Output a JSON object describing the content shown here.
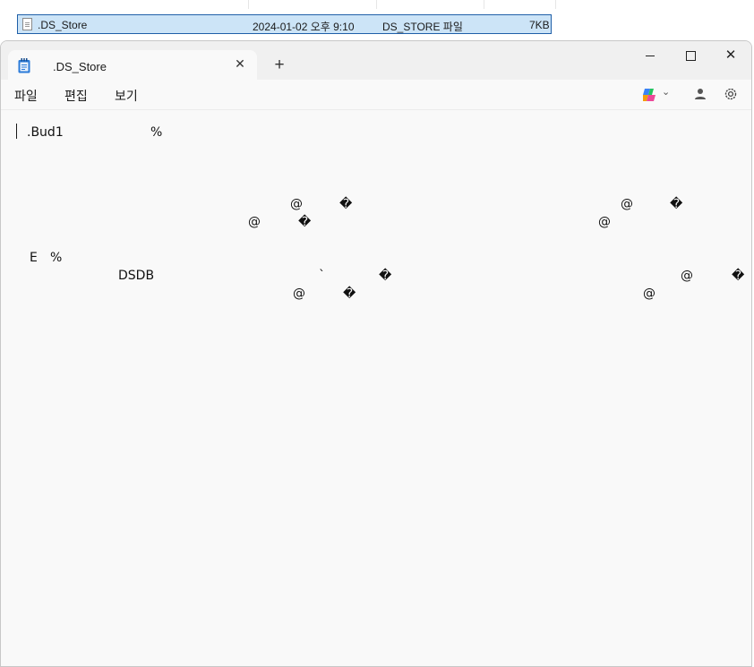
{
  "explorer": {
    "file_row": {
      "name": ".DS_Store",
      "date_modified": "2024-01-02 오후 9:10",
      "type": "DS_STORE 파일",
      "size": "7KB"
    }
  },
  "notepad": {
    "tab_title": ".DS_Store",
    "tab_close_glyph": "✕",
    "new_tab_glyph": "+",
    "window_buttons": {
      "minimize_icon": "minimize-icon",
      "maximize_icon": "maximize-icon",
      "close_glyph": "✕"
    },
    "menu": {
      "file": "파일",
      "edit": "편집",
      "view": "보기"
    },
    "toolbar_icons": [
      "copilot-icon",
      "chevron-down-icon",
      "account-icon",
      "settings-icon"
    ],
    "content_lines": [
      [
        ".Bud1",
        "",
        "",
        "",
        "%",
        "",
        "",
        "",
        "",
        "",
        ""
      ],
      [
        "",
        ""
      ],
      [
        "",
        "",
        "@",
        "",
        "�",
        "",
        "",
        "",
        "",
        "",
        "",
        "",
        "",
        "",
        "",
        "",
        "@",
        "",
        "�",
        "",
        ""
      ],
      [
        "",
        "",
        "",
        "",
        "",
        "",
        "",
        "",
        "",
        "",
        "",
        "@",
        "",
        "�",
        "",
        "",
        "",
        "",
        "",
        "",
        "",
        "",
        "",
        "@"
      ],
      [
        "",
        ""
      ],
      [
        "E",
        "%"
      ],
      [
        "DSDB",
        "",
        "",
        "`",
        "",
        "�",
        "",
        "",
        "",
        "",
        "",
        "",
        "",
        "",
        "",
        "",
        "",
        "@",
        "",
        "�"
      ],
      [
        "",
        "",
        "",
        "",
        "",
        "",
        "",
        "",
        "",
        "",
        "",
        "",
        "@",
        "",
        "�",
        "",
        "",
        "",
        "",
        "",
        "",
        "",
        "",
        "",
        "@"
      ]
    ]
  },
  "colors": {
    "selection_fill": "#cce4f7",
    "selection_border": "#1f5fa8",
    "titlebar": "#f0f0f0",
    "editor_bg": "#f9f9f9"
  }
}
